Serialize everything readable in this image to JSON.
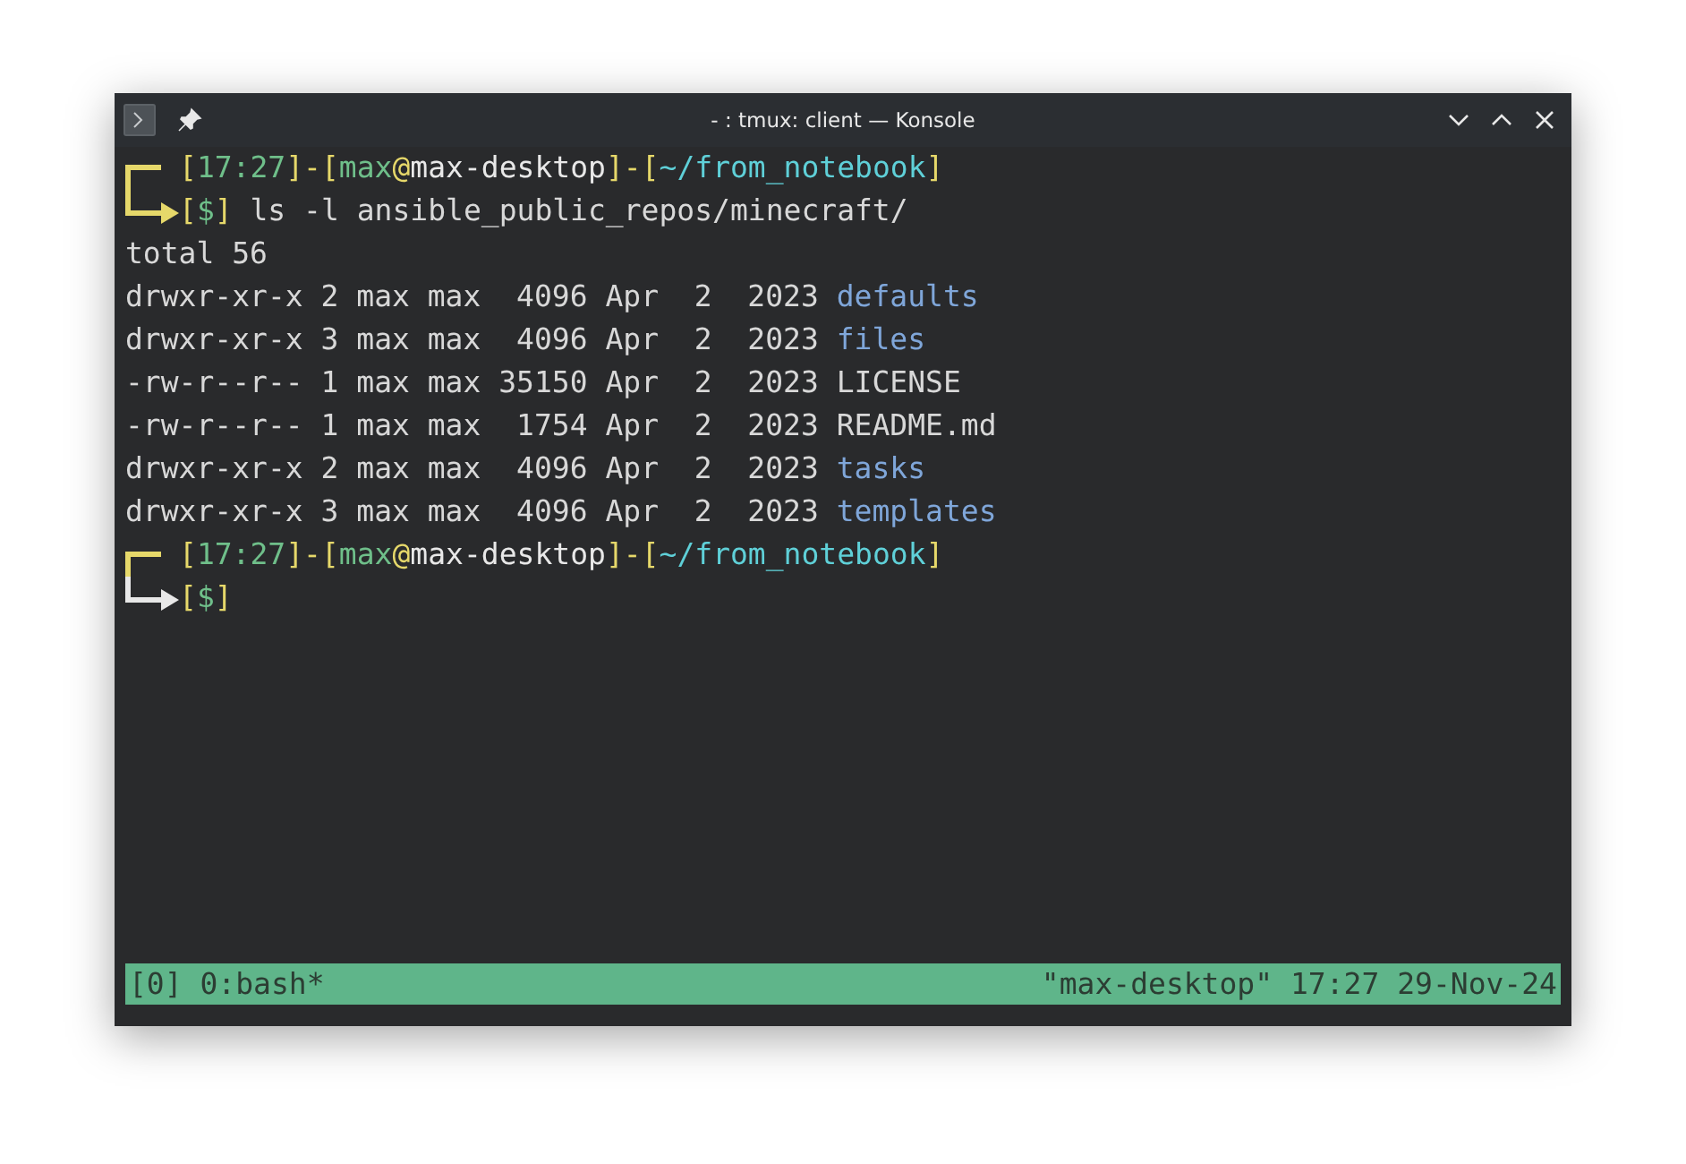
{
  "window": {
    "title": "- : tmux: client — Konsole"
  },
  "terminal": {
    "lines": [
      {
        "kind": "prompt_top",
        "color": "#e6d86a",
        "segments": [
          {
            "kind": "punct",
            "text": "["
          },
          {
            "kind": "time",
            "text": "17:27"
          },
          {
            "kind": "punct",
            "text": "]-["
          },
          {
            "kind": "user",
            "text": "max"
          },
          {
            "kind": "punct",
            "text": "@"
          },
          {
            "kind": "host",
            "text": "max-desktop"
          },
          {
            "kind": "punct",
            "text": "]-["
          },
          {
            "kind": "path",
            "text": "~/from_notebook"
          },
          {
            "kind": "punct",
            "text": "]"
          }
        ]
      },
      {
        "kind": "prompt_bottom",
        "color": "#e6d86a",
        "segments": [
          {
            "kind": "punct",
            "text": "["
          },
          {
            "kind": "sign",
            "text": "$"
          },
          {
            "kind": "punct",
            "text": "]"
          },
          {
            "kind": "plain",
            "text": " ls -l ansible_public_repos/minecraft/"
          }
        ]
      },
      {
        "kind": "output",
        "segments": [
          {
            "kind": "plain",
            "text": "total 56"
          }
        ]
      },
      {
        "kind": "output",
        "segments": [
          {
            "kind": "plain",
            "text": "drwxr-xr-x 2 max max  4096 Apr  2  2023 "
          },
          {
            "kind": "dir",
            "text": "defaults"
          }
        ]
      },
      {
        "kind": "output",
        "segments": [
          {
            "kind": "plain",
            "text": "drwxr-xr-x 3 max max  4096 Apr  2  2023 "
          },
          {
            "kind": "dir",
            "text": "files"
          }
        ]
      },
      {
        "kind": "output",
        "segments": [
          {
            "kind": "plain",
            "text": "-rw-r--r-- 1 max max 35150 Apr  2  2023 LICENSE"
          }
        ]
      },
      {
        "kind": "output",
        "segments": [
          {
            "kind": "plain",
            "text": "-rw-r--r-- 1 max max  1754 Apr  2  2023 README.md"
          }
        ]
      },
      {
        "kind": "output",
        "segments": [
          {
            "kind": "plain",
            "text": "drwxr-xr-x 2 max max  4096 Apr  2  2023 "
          },
          {
            "kind": "dir",
            "text": "tasks"
          }
        ]
      },
      {
        "kind": "output",
        "segments": [
          {
            "kind": "plain",
            "text": "drwxr-xr-x 3 max max  4096 Apr  2  2023 "
          },
          {
            "kind": "dir",
            "text": "templates"
          }
        ]
      },
      {
        "kind": "prompt_top",
        "color": "#e6d86a",
        "segments": [
          {
            "kind": "punct",
            "text": "["
          },
          {
            "kind": "time",
            "text": "17:27"
          },
          {
            "kind": "punct",
            "text": "]-["
          },
          {
            "kind": "user",
            "text": "max"
          },
          {
            "kind": "punct",
            "text": "@"
          },
          {
            "kind": "host",
            "text": "max-desktop"
          },
          {
            "kind": "punct",
            "text": "]-["
          },
          {
            "kind": "path",
            "text": "~/from_notebook"
          },
          {
            "kind": "punct",
            "text": "]"
          }
        ]
      },
      {
        "kind": "prompt_bottom",
        "color": "#e8e8e8",
        "segments": [
          {
            "kind": "punct",
            "text": "["
          },
          {
            "kind": "sign",
            "text": "$"
          },
          {
            "kind": "punct",
            "text": "]"
          }
        ]
      }
    ]
  },
  "status_bar": {
    "left": "[0] 0:bash*",
    "right": "\"max-desktop\" 17:27 29-Nov-24"
  }
}
